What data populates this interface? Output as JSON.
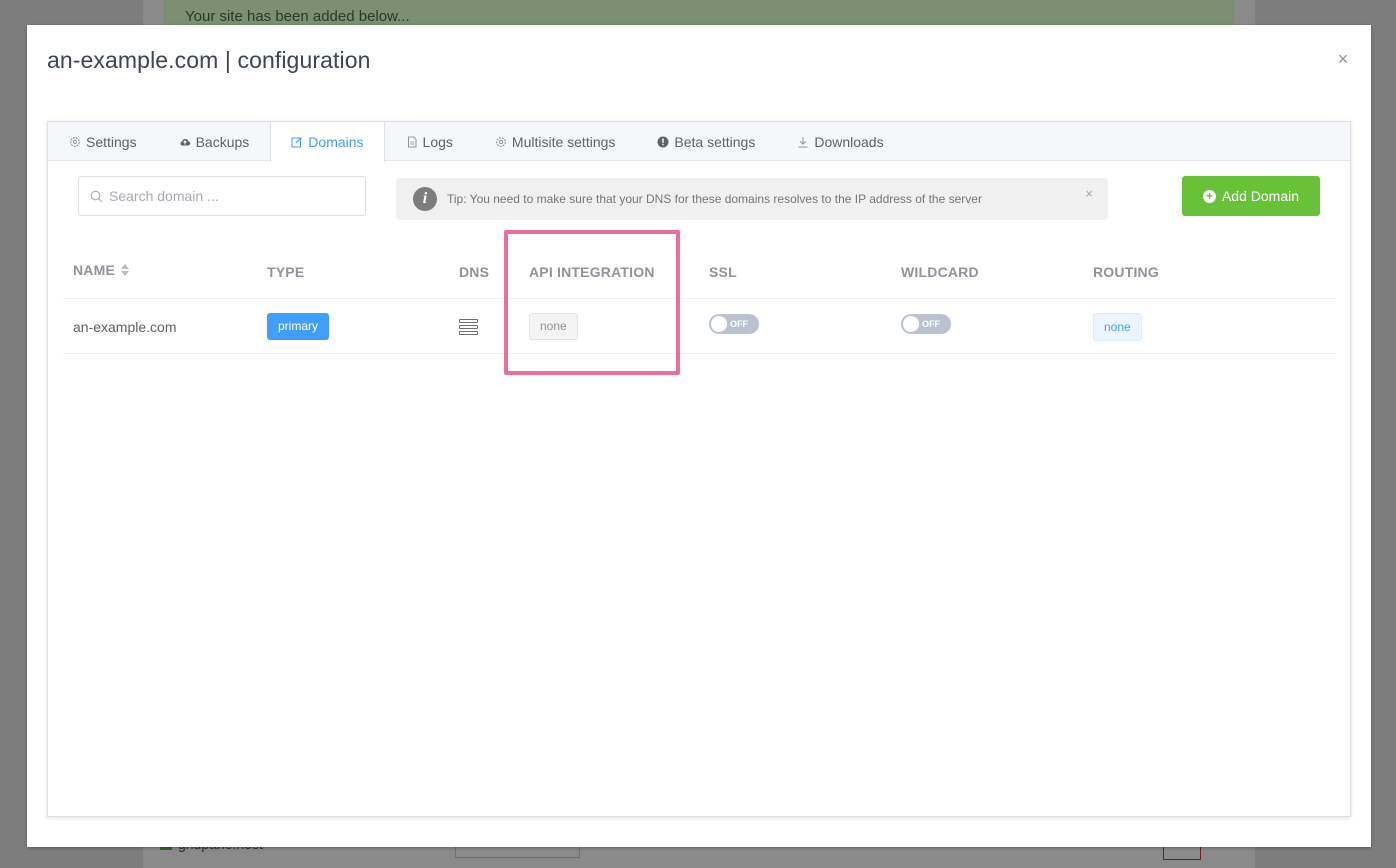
{
  "background": {
    "alert_text": "Your site has been added below...",
    "footer_site": "gridpane.host"
  },
  "modal": {
    "title": "an-example.com | configuration",
    "close_glyph": "×"
  },
  "tabs": [
    {
      "label": "Settings",
      "icon": "gear-icon",
      "active": false
    },
    {
      "label": "Backups",
      "icon": "cloud-upload-icon",
      "active": false
    },
    {
      "label": "Domains",
      "icon": "edit-icon",
      "active": true
    },
    {
      "label": "Logs",
      "icon": "document-icon",
      "active": false
    },
    {
      "label": "Multisite settings",
      "icon": "gear-icon",
      "active": false
    },
    {
      "label": "Beta settings",
      "icon": "warning-circle-icon",
      "active": false
    },
    {
      "label": "Downloads",
      "icon": "download-icon",
      "active": false
    }
  ],
  "search": {
    "placeholder": "Search domain ...",
    "value": ""
  },
  "tip": {
    "icon_glyph": "i",
    "text": "Tip: You need to make sure that your DNS for these domains resolves to the IP address of the server",
    "close_glyph": "×"
  },
  "add_button": {
    "label": "Add Domain"
  },
  "table": {
    "headers": {
      "name": "NAME",
      "type": "TYPE",
      "dns": "DNS",
      "api": "API INTEGRATION",
      "ssl": "SSL",
      "wildcard": "WILDCARD",
      "routing": "ROUTING"
    },
    "rows": [
      {
        "name": "an-example.com",
        "type": "primary",
        "dns_icon": "server-icon",
        "api": "none",
        "ssl": "OFF",
        "wildcard": "OFF",
        "routing": "none"
      }
    ]
  },
  "colors": {
    "accent": "#409eff",
    "success": "#67c23a",
    "highlight": "#ef6d9a"
  }
}
